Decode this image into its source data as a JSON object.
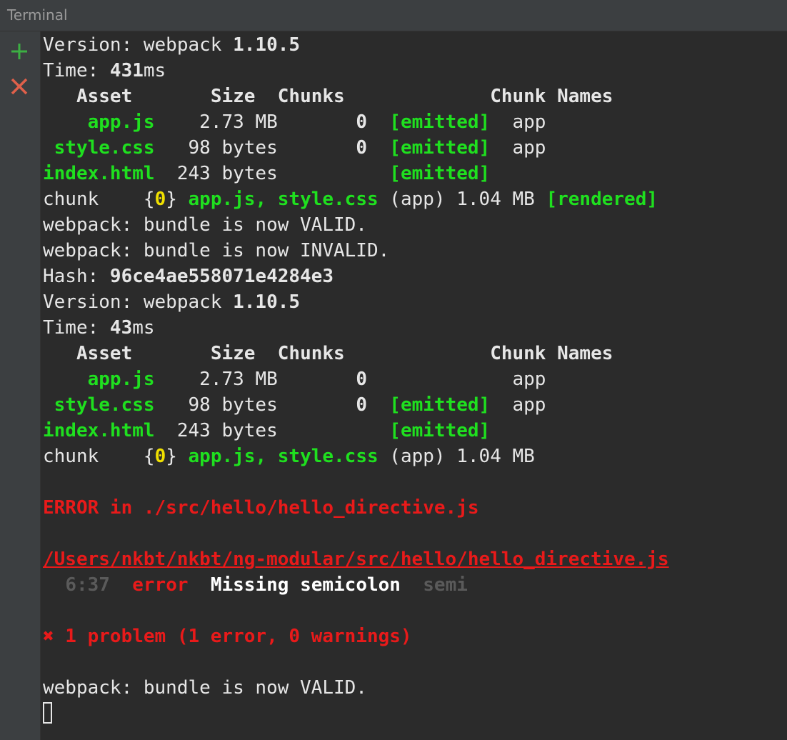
{
  "window": {
    "title": "Terminal"
  },
  "toolbar": {
    "new_icon": "plus-icon",
    "close_icon": "close-icon"
  },
  "colors": {
    "ok": "#1fe01f",
    "chunk_id": "#f0e000",
    "error": "#e81a1a",
    "rule": "#5a5a5a"
  },
  "build1": {
    "version_label": "Version: webpack ",
    "version": "1.10.5",
    "time_label": "Time: ",
    "time": "431",
    "time_unit": "ms",
    "headers": {
      "asset": "Asset",
      "size": "Size",
      "chunks": "Chunks",
      "chunk_names": "Chunk Names"
    },
    "assets": [
      {
        "name": "app.js",
        "size": "2.73 MB",
        "chunks": "0",
        "status": "[emitted]",
        "chunk_name": "app"
      },
      {
        "name": "style.css",
        "size": "98 bytes",
        "chunks": "0",
        "status": "[emitted]",
        "chunk_name": "app"
      },
      {
        "name": "index.html",
        "size": "243 bytes",
        "chunks": "",
        "status": "[emitted]",
        "chunk_name": ""
      }
    ],
    "chunk": {
      "label": "chunk",
      "open": "{",
      "id": "0",
      "close": "}",
      "files": "app.js, style.css",
      "name": "(app)",
      "size": "1.04 MB",
      "status": "[rendered]"
    }
  },
  "messages": {
    "valid1": "webpack: bundle is now VALID.",
    "invalid": "webpack: bundle is now INVALID.",
    "valid2": "webpack: bundle is now VALID."
  },
  "build2": {
    "hash_label": "Hash: ",
    "hash": "96ce4ae558071e4284e3",
    "version_label": "Version: webpack ",
    "version": "1.10.5",
    "time_label": "Time: ",
    "time": "43",
    "time_unit": "ms",
    "headers": {
      "asset": "Asset",
      "size": "Size",
      "chunks": "Chunks",
      "chunk_names": "Chunk Names"
    },
    "assets": [
      {
        "name": "app.js",
        "size": "2.73 MB",
        "chunks": "0",
        "status": "",
        "chunk_name": "app"
      },
      {
        "name": "style.css",
        "size": "98 bytes",
        "chunks": "0",
        "status": "[emitted]",
        "chunk_name": "app"
      },
      {
        "name": "index.html",
        "size": "243 bytes",
        "chunks": "",
        "status": "[emitted]",
        "chunk_name": ""
      }
    ],
    "chunk": {
      "label": "chunk",
      "open": "{",
      "id": "0",
      "close": "}",
      "files": "app.js, style.css",
      "name": "(app)",
      "size": "1.04 MB"
    }
  },
  "error": {
    "heading": "ERROR in ./src/hello/hello_directive.js",
    "file_path": "/Users/nkbt/nkbt/ng-modular/src/hello/hello_directive.js",
    "location": "6:37",
    "severity": "error",
    "message": "Missing semicolon",
    "rule": "semi",
    "summary": "✖ 1 problem (1 error, 0 warnings)"
  }
}
